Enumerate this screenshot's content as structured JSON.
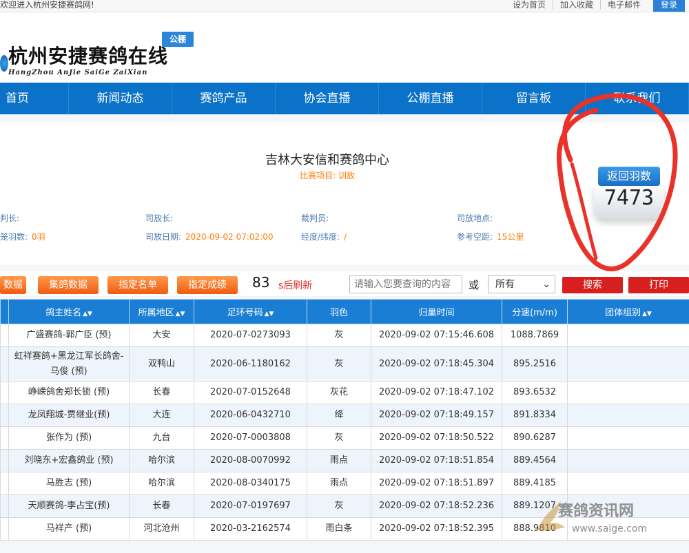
{
  "topbar": {
    "welcome": "欢迎进入杭州安捷赛鸽网!",
    "links": [
      "设为首页",
      "加入收藏",
      "电子邮件"
    ],
    "login": "登录"
  },
  "header": {
    "logo_title": "杭州安捷赛鸽在线",
    "logo_sub": "HangZhou AnJie SaiGe ZaiXian",
    "badge": "公棚"
  },
  "nav": [
    "首页",
    "新闻动态",
    "赛鸽产品",
    "协会直播",
    "公棚直播",
    "留言板",
    "联系我们"
  ],
  "race": {
    "title": "吉林大安信和赛鸽中心",
    "subtitle": "比赛项目: 训放",
    "fields": {
      "judge_head": {
        "label": "判长:",
        "value": ""
      },
      "release_head": {
        "label": "司放长:",
        "value": ""
      },
      "judge": {
        "label": "裁判员:",
        "value": ""
      },
      "release_place": {
        "label": "司放地点:",
        "value": ""
      },
      "basket_count": {
        "label": "笼羽数:",
        "value": "0羽"
      },
      "release_date": {
        "label": "司放日期:",
        "value": "2020-09-02 07:02:00"
      },
      "coords": {
        "label": "经度/纬度:",
        "value": "/"
      },
      "distance": {
        "label": "参考空距:",
        "value": "15公里"
      }
    },
    "return": {
      "label": "返回羽数",
      "count": "7473"
    }
  },
  "toolbar": {
    "btn_data": "数据",
    "btn_gather": "集鸽数据",
    "btn_list": "指定名单",
    "btn_results": "指定成绩",
    "countdown": "83",
    "refresh_label": "s后刷新",
    "search_placeholder": "请输入您要查询的内容",
    "or_label": "或",
    "select_value": "所有",
    "search_btn": "搜索",
    "print_btn": "打印"
  },
  "table": {
    "headers": [
      "鸽主姓名",
      "所属地区",
      "足环号码",
      "羽色",
      "归巢时间",
      "分速(m/m)",
      "团体组别"
    ],
    "sortable": [
      true,
      true,
      true,
      false,
      false,
      false,
      true
    ],
    "rows": [
      {
        "owner": "广盛赛鸽-郭广臣 (预)",
        "area": "大安",
        "ring": "2020-07-0273093",
        "color": "灰",
        "time": "2020-09-02 07:15:46.608",
        "speed": "1088.7869",
        "group": ""
      },
      {
        "owner": "虹祥赛鸽+黑龙江军长鸽舍-马俊 (预)",
        "area": "双鸭山",
        "ring": "2020-06-1180162",
        "color": "灰",
        "time": "2020-09-02 07:18:45.304",
        "speed": "895.2516",
        "group": ""
      },
      {
        "owner": "峥嵘鸽舍郑长锁 (预)",
        "area": "长春",
        "ring": "2020-07-0152648",
        "color": "灰花",
        "time": "2020-09-02 07:18:47.102",
        "speed": "893.6532",
        "group": ""
      },
      {
        "owner": "龙凤翔城-贾继业(预)",
        "area": "大连",
        "ring": "2020-06-0432710",
        "color": "绛",
        "time": "2020-09-02 07:18:49.157",
        "speed": "891.8334",
        "group": ""
      },
      {
        "owner": "张作为 (预)",
        "area": "九台",
        "ring": "2020-07-0003808",
        "color": "灰",
        "time": "2020-09-02 07:18:50.522",
        "speed": "890.6287",
        "group": ""
      },
      {
        "owner": "刘晓东+宏鑫鸽业 (预)",
        "area": "哈尔滨",
        "ring": "2020-08-0070992",
        "color": "雨点",
        "time": "2020-09-02 07:18:51.854",
        "speed": "889.4564",
        "group": ""
      },
      {
        "owner": "马胜志 (预)",
        "area": "哈尔滨",
        "ring": "2020-08-0340175",
        "color": "雨点",
        "time": "2020-09-02 07:18:51.897",
        "speed": "889.4185",
        "group": ""
      },
      {
        "owner": "天顺赛鸽-李占宝(预)",
        "area": "长春",
        "ring": "2020-07-0197697",
        "color": "灰",
        "time": "2020-09-02 07:18:52.236",
        "speed": "889.1207",
        "group": ""
      },
      {
        "owner": "马祥产 (预)",
        "area": "河北沧州",
        "ring": "2020-03-2162574",
        "color": "雨白条",
        "time": "2020-09-02 07:18:52.395",
        "speed": "888.9810",
        "group": ""
      }
    ]
  },
  "watermark": {
    "text": "赛鸽资讯网",
    "url": "www.saige.com"
  },
  "colors": {
    "nav": "#0a72c8",
    "accent_orange": "#ff7a00",
    "button_red": "#d81f1f",
    "table_header": "#1a7fd4",
    "annotation": "#e8322a"
  }
}
